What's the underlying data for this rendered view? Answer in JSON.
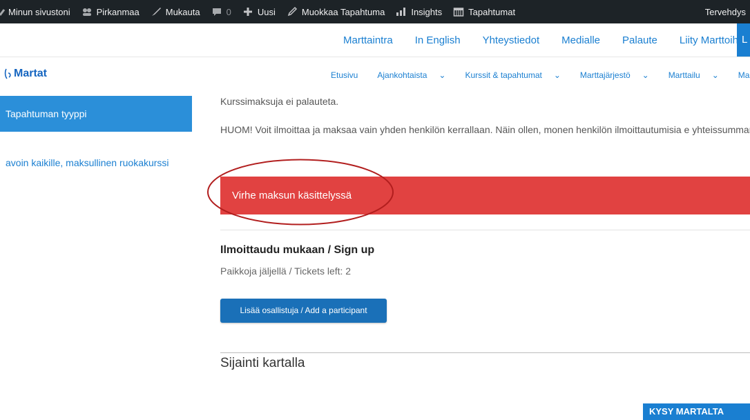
{
  "admin_bar": {
    "items": [
      {
        "label": "Minun sivustoni",
        "icon": "dashboard-icon"
      },
      {
        "label": "Pirkanmaa",
        "icon": "multisite-icon"
      },
      {
        "label": "Mukauta",
        "icon": "brush-icon"
      },
      {
        "label": "0",
        "icon": "comment-icon"
      },
      {
        "label": "Uusi",
        "icon": "plus-icon"
      },
      {
        "label": "Muokkaa Tapahtuma",
        "icon": "edit-icon"
      },
      {
        "label": "Insights",
        "icon": "chart-icon"
      },
      {
        "label": "Tapahtumat",
        "icon": "calendar-icon"
      }
    ],
    "greeting": "Tervehdys"
  },
  "top_nav": {
    "links": [
      "Marttaintra",
      "In English",
      "Yhteystiedot",
      "Medialle",
      "Palaute",
      "Liity Marttoihin"
    ],
    "tab_partial": "L"
  },
  "logo": {
    "text": "Martat"
  },
  "main_nav": {
    "items": [
      {
        "label": "Etusivu",
        "dropdown": false
      },
      {
        "label": "Ajankohtaista",
        "dropdown": true
      },
      {
        "label": "Kurssit & tapahtumat",
        "dropdown": true
      },
      {
        "label": "Marttajärjestö",
        "dropdown": true
      },
      {
        "label": "Marttailu",
        "dropdown": true
      },
      {
        "label": "Marttakoulu",
        "dropdown": false
      }
    ]
  },
  "sidebar": {
    "heading": "Tapahtuman tyyppi",
    "value": "avoin kaikille, maksullinen ruokakurssi"
  },
  "content": {
    "refund_note": "Kurssimaksuja ei palauteta.",
    "notice": "HUOM! Voit ilmoittaa ja maksaa vain yhden henkilön kerrallaan. Näin ollen, monen henkilön ilmoittautumisia e yhteissummana.",
    "error_message": "Virhe maksun käsittelyssä",
    "signup_title": "Ilmoittaudu mukaan / Sign up",
    "tickets_left": "Paikkoja jäljellä / Tickets left: 2",
    "add_participant": "Lisää osallistuja / Add a participant",
    "map_title": "Sijainti kartalla"
  },
  "floating": {
    "ask_button": "KYSY MARTALTA"
  },
  "colors": {
    "accent": "#1a7fd1",
    "error": "#e14241",
    "admin_bar": "#1d2327",
    "annotation": "#b21e1e"
  }
}
